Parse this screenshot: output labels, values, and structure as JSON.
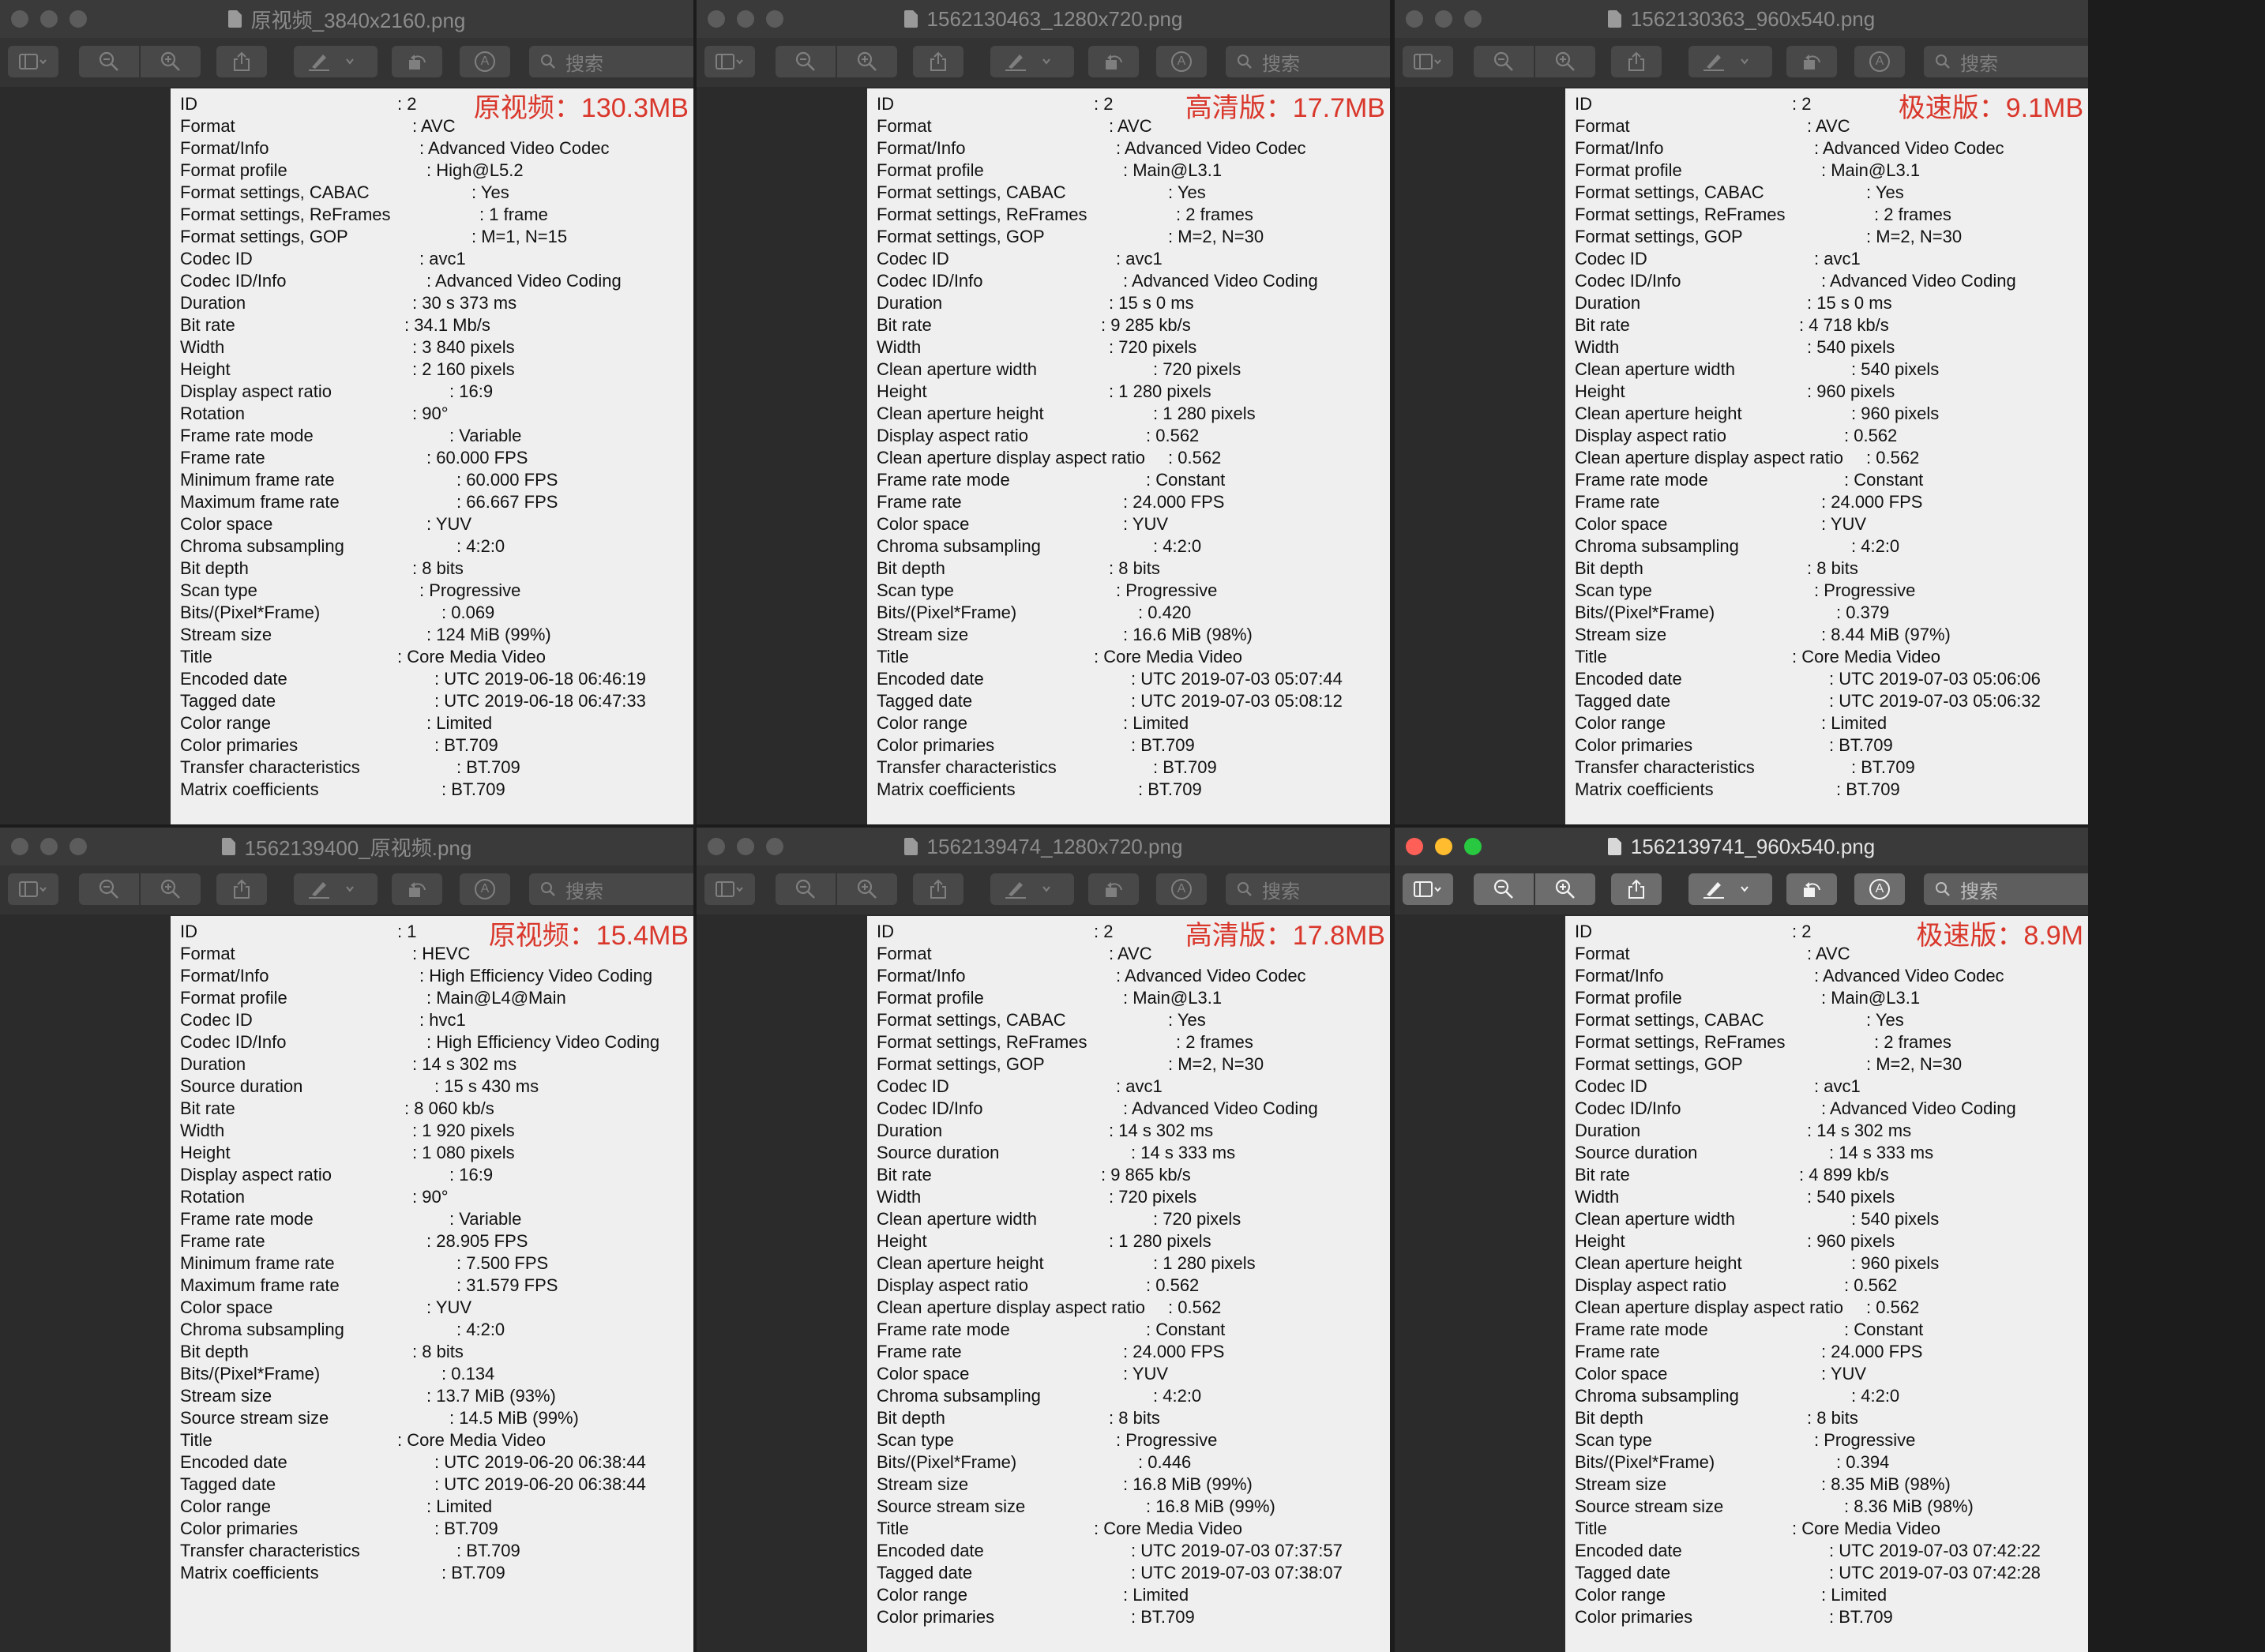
{
  "windows": [
    {
      "title": "原视频_3840x2160.png",
      "active": false,
      "search_placeholder": "搜索",
      "badge": "原视频：130.3MB",
      "rows": [
        [
          "ID",
          "2",
          28
        ],
        [
          "Format",
          "AVC",
          30
        ],
        [
          "Format/Info",
          "Advanced Video Codec",
          31
        ],
        [
          "Format profile",
          "High@L5.2",
          32
        ],
        [
          "Format settings, CABAC",
          "Yes",
          38
        ],
        [
          "Format settings, ReFrames",
          "1 frame",
          39
        ],
        [
          "Format settings, GOP",
          "M=1, N=15",
          38
        ],
        [
          "Codec ID",
          "avc1",
          31
        ],
        [
          "Codec ID/Info",
          "Advanced Video Coding",
          32
        ],
        [
          "Duration",
          "30 s 373 ms",
          30
        ],
        [
          "Bit rate",
          "34.1 Mb/s",
          29
        ],
        [
          "Width",
          "3 840 pixels",
          30
        ],
        [
          "Height",
          "2 160 pixels",
          30
        ],
        [
          "Display aspect ratio",
          "16:9",
          35
        ],
        [
          "Rotation",
          "90°",
          30
        ],
        [
          "Frame rate mode",
          "Variable",
          35
        ],
        [
          "Frame rate",
          "60.000 FPS",
          32
        ],
        [
          "Minimum frame rate",
          "60.000 FPS",
          36
        ],
        [
          "Maximum frame rate",
          "66.667 FPS",
          36
        ],
        [
          "Color space",
          "YUV",
          32
        ],
        [
          "Chroma subsampling",
          "4:2:0",
          36
        ],
        [
          "Bit depth",
          "8 bits",
          30
        ],
        [
          "Scan type",
          "Progressive",
          31
        ],
        [
          "Bits/(Pixel*Frame)",
          "0.069",
          34
        ],
        [
          "Stream size",
          "124 MiB (99%)",
          32
        ],
        [
          "Title",
          "Core Media Video",
          28
        ],
        [
          "Encoded date",
          "UTC 2019-06-18 06:46:19",
          33
        ],
        [
          "Tagged date",
          "UTC 2019-06-18 06:47:33",
          33
        ],
        [
          "Color range",
          "Limited",
          32
        ],
        [
          "Color primaries",
          "BT.709",
          33
        ],
        [
          "Transfer characteristics",
          "BT.709",
          36
        ],
        [
          "Matrix coefficients",
          "BT.709",
          34
        ]
      ]
    },
    {
      "title": "1562130463_1280x720.png",
      "active": false,
      "search_placeholder": "搜索",
      "badge": "高清版：17.7MB",
      "rows": [
        [
          "ID",
          "2",
          28
        ],
        [
          "Format",
          "AVC",
          30
        ],
        [
          "Format/Info",
          "Advanced Video Codec",
          31
        ],
        [
          "Format profile",
          "Main@L3.1",
          32
        ],
        [
          "Format settings, CABAC",
          "Yes",
          38
        ],
        [
          "Format settings, ReFrames",
          "2 frames",
          39
        ],
        [
          "Format settings, GOP",
          "M=2, N=30",
          38
        ],
        [
          "Codec ID",
          "avc1",
          31
        ],
        [
          "Codec ID/Info",
          "Advanced Video Coding",
          32
        ],
        [
          "Duration",
          "15 s 0 ms",
          30
        ],
        [
          "Bit rate",
          "9 285 kb/s",
          29
        ],
        [
          "Width",
          "720 pixels",
          30
        ],
        [
          "Clean aperture width",
          "720 pixels",
          36
        ],
        [
          "Height",
          "1 280 pixels",
          30
        ],
        [
          "Clean aperture height",
          "1 280 pixels",
          36
        ],
        [
          "Display aspect ratio",
          "0.562",
          35
        ],
        [
          "Clean aperture display aspect ratio",
          "0.562",
          38
        ],
        [
          "Frame rate mode",
          "Constant",
          35
        ],
        [
          "Frame rate",
          "24.000 FPS",
          32
        ],
        [
          "Color space",
          "YUV",
          32
        ],
        [
          "Chroma subsampling",
          "4:2:0",
          36
        ],
        [
          "Bit depth",
          "8 bits",
          30
        ],
        [
          "Scan type",
          "Progressive",
          31
        ],
        [
          "Bits/(Pixel*Frame)",
          "0.420",
          34
        ],
        [
          "Stream size",
          "16.6 MiB (98%)",
          32
        ],
        [
          "Title",
          "Core Media Video",
          28
        ],
        [
          "Encoded date",
          "UTC 2019-07-03 05:07:44",
          33
        ],
        [
          "Tagged date",
          "UTC 2019-07-03 05:08:12",
          33
        ],
        [
          "Color range",
          "Limited",
          32
        ],
        [
          "Color primaries",
          "BT.709",
          33
        ],
        [
          "Transfer characteristics",
          "BT.709",
          36
        ],
        [
          "Matrix coefficients",
          "BT.709",
          34
        ]
      ]
    },
    {
      "title": "1562130363_960x540.png",
      "active": false,
      "search_placeholder": "搜索",
      "badge": "极速版：9.1MB",
      "rows": [
        [
          "ID",
          "2",
          28
        ],
        [
          "Format",
          "AVC",
          30
        ],
        [
          "Format/Info",
          "Advanced Video Codec",
          31
        ],
        [
          "Format profile",
          "Main@L3.1",
          32
        ],
        [
          "Format settings, CABAC",
          "Yes",
          38
        ],
        [
          "Format settings, ReFrames",
          "2 frames",
          39
        ],
        [
          "Format settings, GOP",
          "M=2, N=30",
          38
        ],
        [
          "Codec ID",
          "avc1",
          31
        ],
        [
          "Codec ID/Info",
          "Advanced Video Coding",
          32
        ],
        [
          "Duration",
          "15 s 0 ms",
          30
        ],
        [
          "Bit rate",
          "4 718 kb/s",
          29
        ],
        [
          "Width",
          "540 pixels",
          30
        ],
        [
          "Clean aperture width",
          "540 pixels",
          36
        ],
        [
          "Height",
          "960 pixels",
          30
        ],
        [
          "Clean aperture height",
          "960 pixels",
          36
        ],
        [
          "Display aspect ratio",
          "0.562",
          35
        ],
        [
          "Clean aperture display aspect ratio",
          "0.562",
          38
        ],
        [
          "Frame rate mode",
          "Constant",
          35
        ],
        [
          "Frame rate",
          "24.000 FPS",
          32
        ],
        [
          "Color space",
          "YUV",
          32
        ],
        [
          "Chroma subsampling",
          "4:2:0",
          36
        ],
        [
          "Bit depth",
          "8 bits",
          30
        ],
        [
          "Scan type",
          "Progressive",
          31
        ],
        [
          "Bits/(Pixel*Frame)",
          "0.379",
          34
        ],
        [
          "Stream size",
          "8.44 MiB (97%)",
          32
        ],
        [
          "Title",
          "Core Media Video",
          28
        ],
        [
          "Encoded date",
          "UTC 2019-07-03 05:06:06",
          33
        ],
        [
          "Tagged date",
          "UTC 2019-07-03 05:06:32",
          33
        ],
        [
          "Color range",
          "Limited",
          32
        ],
        [
          "Color primaries",
          "BT.709",
          33
        ],
        [
          "Transfer characteristics",
          "BT.709",
          36
        ],
        [
          "Matrix coefficients",
          "BT.709",
          34
        ]
      ]
    },
    {
      "title": "1562139400_原视频.png",
      "active": false,
      "search_placeholder": "搜索",
      "badge": "原视频：15.4MB",
      "rows": [
        [
          "ID",
          "1",
          28
        ],
        [
          "Format",
          "HEVC",
          30
        ],
        [
          "Format/Info",
          "High Efficiency Video Coding",
          31
        ],
        [
          "Format profile",
          "Main@L4@Main",
          32
        ],
        [
          "Codec ID",
          "hvc1",
          31
        ],
        [
          "Codec ID/Info",
          "High Efficiency Video Coding",
          32
        ],
        [
          "Duration",
          "14 s 302 ms",
          30
        ],
        [
          "Source duration",
          "15 s 430 ms",
          33
        ],
        [
          "Bit rate",
          "8 060 kb/s",
          29
        ],
        [
          "Width",
          "1 920 pixels",
          30
        ],
        [
          "Height",
          "1 080 pixels",
          30
        ],
        [
          "Display aspect ratio",
          "16:9",
          35
        ],
        [
          "Rotation",
          "90°",
          30
        ],
        [
          "Frame rate mode",
          "Variable",
          35
        ],
        [
          "Frame rate",
          "28.905 FPS",
          32
        ],
        [
          "Minimum frame rate",
          "7.500 FPS",
          36
        ],
        [
          "Maximum frame rate",
          "31.579 FPS",
          36
        ],
        [
          "Color space",
          "YUV",
          32
        ],
        [
          "Chroma subsampling",
          "4:2:0",
          36
        ],
        [
          "Bit depth",
          "8 bits",
          30
        ],
        [
          "Bits/(Pixel*Frame)",
          "0.134",
          34
        ],
        [
          "Stream size",
          "13.7 MiB (93%)",
          32
        ],
        [
          "Source stream size",
          "14.5 MiB (99%)",
          35
        ],
        [
          "Title",
          "Core Media Video",
          28
        ],
        [
          "Encoded date",
          "UTC 2019-06-20 06:38:44",
          33
        ],
        [
          "Tagged date",
          "UTC 2019-06-20 06:38:44",
          33
        ],
        [
          "Color range",
          "Limited",
          32
        ],
        [
          "Color primaries",
          "BT.709",
          33
        ],
        [
          "Transfer characteristics",
          "BT.709",
          36
        ],
        [
          "Matrix coefficients",
          "BT.709",
          34
        ]
      ]
    },
    {
      "title": "1562139474_1280x720.png",
      "active": false,
      "search_placeholder": "搜索",
      "badge": "高清版：17.8MB",
      "rows": [
        [
          "ID",
          "2",
          28
        ],
        [
          "Format",
          "AVC",
          30
        ],
        [
          "Format/Info",
          "Advanced Video Codec",
          31
        ],
        [
          "Format profile",
          "Main@L3.1",
          32
        ],
        [
          "Format settings, CABAC",
          "Yes",
          38
        ],
        [
          "Format settings, ReFrames",
          "2 frames",
          39
        ],
        [
          "Format settings, GOP",
          "M=2, N=30",
          38
        ],
        [
          "Codec ID",
          "avc1",
          31
        ],
        [
          "Codec ID/Info",
          "Advanced Video Coding",
          32
        ],
        [
          "Duration",
          "14 s 302 ms",
          30
        ],
        [
          "Source duration",
          "14 s 333 ms",
          33
        ],
        [
          "Bit rate",
          "9 865 kb/s",
          29
        ],
        [
          "Width",
          "720 pixels",
          30
        ],
        [
          "Clean aperture width",
          "720 pixels",
          36
        ],
        [
          "Height",
          "1 280 pixels",
          30
        ],
        [
          "Clean aperture height",
          "1 280 pixels",
          36
        ],
        [
          "Display aspect ratio",
          "0.562",
          35
        ],
        [
          "Clean aperture display aspect ratio",
          "0.562",
          38
        ],
        [
          "Frame rate mode",
          "Constant",
          35
        ],
        [
          "Frame rate",
          "24.000 FPS",
          32
        ],
        [
          "Color space",
          "YUV",
          32
        ],
        [
          "Chroma subsampling",
          "4:2:0",
          36
        ],
        [
          "Bit depth",
          "8 bits",
          30
        ],
        [
          "Scan type",
          "Progressive",
          31
        ],
        [
          "Bits/(Pixel*Frame)",
          "0.446",
          34
        ],
        [
          "Stream size",
          "16.8 MiB (99%)",
          32
        ],
        [
          "Source stream size",
          "16.8 MiB (99%)",
          35
        ],
        [
          "Title",
          "Core Media Video",
          28
        ],
        [
          "Encoded date",
          "UTC 2019-07-03 07:37:57",
          33
        ],
        [
          "Tagged date",
          "UTC 2019-07-03 07:38:07",
          33
        ],
        [
          "Color range",
          "Limited",
          32
        ],
        [
          "Color primaries",
          "BT.709",
          33
        ]
      ]
    },
    {
      "title": "1562139741_960x540.png",
      "active": true,
      "search_placeholder": "搜索",
      "badge": "极速版：8.9M",
      "rows": [
        [
          "ID",
          "2",
          28
        ],
        [
          "Format",
          "AVC",
          30
        ],
        [
          "Format/Info",
          "Advanced Video Codec",
          31
        ],
        [
          "Format profile",
          "Main@L3.1",
          32
        ],
        [
          "Format settings, CABAC",
          "Yes",
          38
        ],
        [
          "Format settings, ReFrames",
          "2 frames",
          39
        ],
        [
          "Format settings, GOP",
          "M=2, N=30",
          38
        ],
        [
          "Codec ID",
          "avc1",
          31
        ],
        [
          "Codec ID/Info",
          "Advanced Video Coding",
          32
        ],
        [
          "Duration",
          "14 s 302 ms",
          30
        ],
        [
          "Source duration",
          "14 s 333 ms",
          33
        ],
        [
          "Bit rate",
          "4 899 kb/s",
          29
        ],
        [
          "Width",
          "540 pixels",
          30
        ],
        [
          "Clean aperture width",
          "540 pixels",
          36
        ],
        [
          "Height",
          "960 pixels",
          30
        ],
        [
          "Clean aperture height",
          "960 pixels",
          36
        ],
        [
          "Display aspect ratio",
          "0.562",
          35
        ],
        [
          "Clean aperture display aspect ratio",
          "0.562",
          38
        ],
        [
          "Frame rate mode",
          "Constant",
          35
        ],
        [
          "Frame rate",
          "24.000 FPS",
          32
        ],
        [
          "Color space",
          "YUV",
          32
        ],
        [
          "Chroma subsampling",
          "4:2:0",
          36
        ],
        [
          "Bit depth",
          "8 bits",
          30
        ],
        [
          "Scan type",
          "Progressive",
          31
        ],
        [
          "Bits/(Pixel*Frame)",
          "0.394",
          34
        ],
        [
          "Stream size",
          "8.35 MiB (98%)",
          32
        ],
        [
          "Source stream size",
          "8.36 MiB (98%)",
          35
        ],
        [
          "Title",
          "Core Media Video",
          28
        ],
        [
          "Encoded date",
          "UTC 2019-07-03 07:42:22",
          33
        ],
        [
          "Tagged date",
          "UTC 2019-07-03 07:42:28",
          33
        ],
        [
          "Color range",
          "Limited",
          32
        ],
        [
          "Color primaries",
          "BT.709",
          33
        ]
      ]
    }
  ],
  "colors": {
    "badge": "#d9372b",
    "close": "#fe5f57",
    "minimize": "#febc2e",
    "zoom": "#28c840"
  },
  "icons": [
    "sidebar-icon",
    "chevron-down-icon",
    "zoom-out-icon",
    "zoom-in-icon",
    "share-icon",
    "markup-pen-icon",
    "rotate-icon",
    "annotate-icon",
    "search-icon",
    "document-icon"
  ]
}
